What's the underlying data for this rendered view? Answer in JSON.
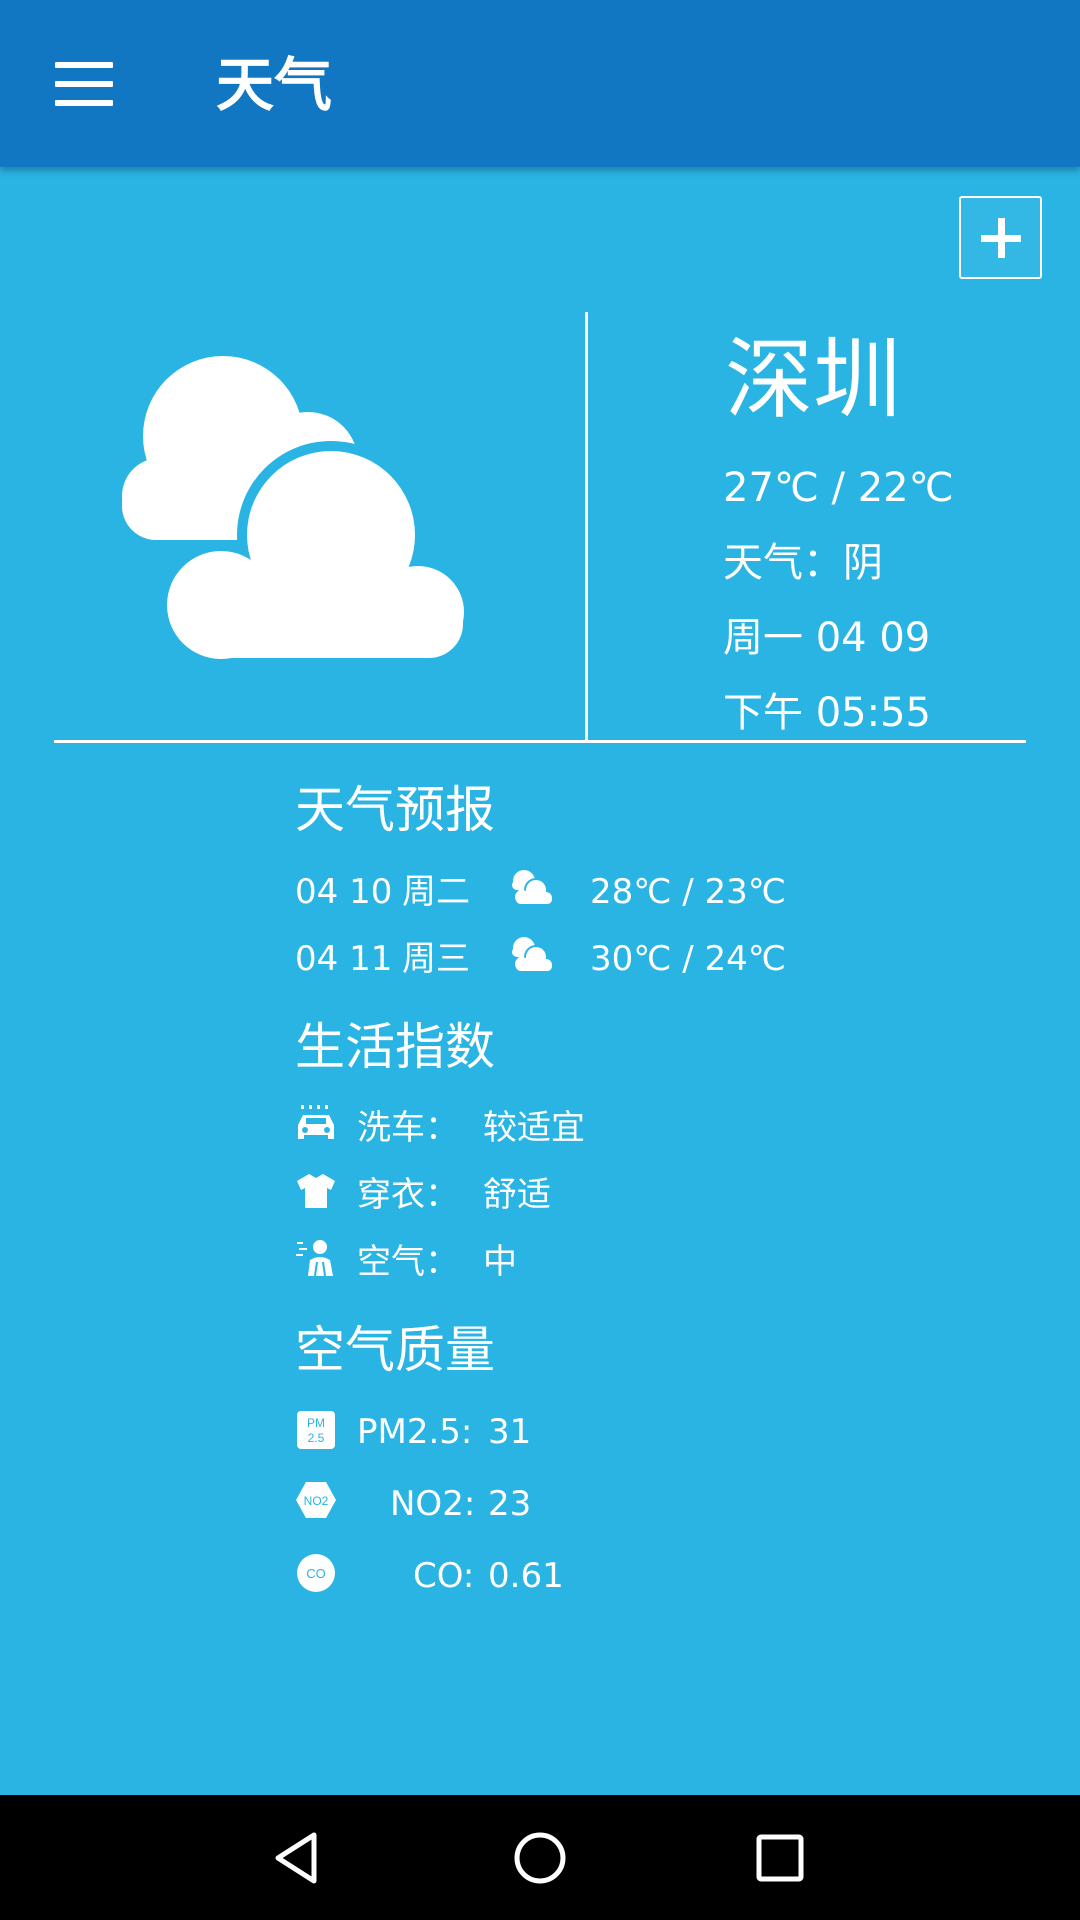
{
  "app_bar": {
    "title": "天气",
    "menu_icon": "hamburger-menu-icon"
  },
  "add_city": {
    "icon": "plus-icon"
  },
  "current": {
    "icon": "partly-cloudy-icon",
    "city": "深圳",
    "temp_range": "27℃ / 22℃",
    "condition": "天气：阴",
    "date": "周一 04 09",
    "time": "下午 05:55"
  },
  "forecast": {
    "title": "天气预报",
    "days": [
      {
        "date": "04 10",
        "weekday": "周二",
        "icon": "cloudy-icon",
        "temp": "28℃ / 23℃"
      },
      {
        "date": "04 11",
        "weekday": "周三",
        "icon": "cloudy-icon",
        "temp": "30℃ / 24℃"
      }
    ]
  },
  "life_index": {
    "title": "生活指数",
    "items": [
      {
        "icon": "car-wash-icon",
        "label": "洗车：",
        "value": "较适宜"
      },
      {
        "icon": "clothes-icon",
        "label": "穿衣：",
        "value": "舒适"
      },
      {
        "icon": "air-person-icon",
        "label": "空气：",
        "value": "中"
      }
    ]
  },
  "air_quality": {
    "title": "空气质量",
    "items": [
      {
        "icon": "pm25-icon",
        "icon_text": "PM 2.5",
        "label": "PM2.5:",
        "value": "31"
      },
      {
        "icon": "no2-icon",
        "icon_text": "NO2",
        "label": "NO2:",
        "value": "23"
      },
      {
        "icon": "co-icon",
        "icon_text": "CO",
        "label": "CO:",
        "value": "0.61"
      }
    ]
  },
  "colors": {
    "background": "#29b4e4",
    "app_bar": "#1277c2",
    "text": "#ffffff",
    "nav_bar": "#000000"
  },
  "nav": {
    "back_icon": "back-triangle-icon",
    "home_icon": "home-circle-icon",
    "recents_icon": "recents-square-icon"
  }
}
